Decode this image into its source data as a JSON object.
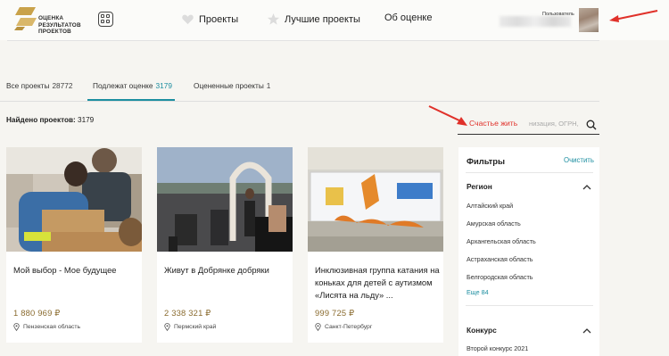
{
  "brand": {
    "logo_text": "ОЦЕНКА РЕЗУЛЬТАТОВ ПРОЕКТОВ",
    "logo_line1": "ОЦЕНКА",
    "logo_line2": "РЕЗУЛЬТАТОВ",
    "logo_line3": "ПРОЕКТОВ",
    "accent": "#1c8ea0",
    "gold": "#c9a24a"
  },
  "nav": {
    "items": [
      {
        "label": "Проекты",
        "icon": "heart-icon"
      },
      {
        "label": "Лучшие проекты",
        "icon": "star-icon"
      },
      {
        "label": "Об оценке",
        "icon": ""
      }
    ]
  },
  "user": {
    "label": "Пользователь"
  },
  "tabs": [
    {
      "label": "Все проекты",
      "count": "28772",
      "active": false
    },
    {
      "label": "Подлежат оценке",
      "count": "3179",
      "active": true
    },
    {
      "label": "Оцененные проекты",
      "count": "1",
      "active": false
    }
  ],
  "results": {
    "label": "Найдено проектов:",
    "count": "3179"
  },
  "search": {
    "value": "Счастье жить",
    "placeholder": "низация, ОГРН, И"
  },
  "cards": [
    {
      "title": "Мой выбор - Мое будущее",
      "price": "1 880 969 ₽",
      "region": "Пензенская область"
    },
    {
      "title": "Живут в Добрянке добряки",
      "price": "2 338 321 ₽",
      "region": "Пермский край"
    },
    {
      "title": "Инклюзивная группа катания на коньках для детей с аутизмом «Лисята на льду» ...",
      "price": "999 725 ₽",
      "region": "Санкт-Петербург"
    }
  ],
  "filters": {
    "title": "Фильтры",
    "clear": "Очистить",
    "region": {
      "title": "Регион",
      "items": [
        "Алтайский край",
        "Амурская область",
        "Архангельская область",
        "Астраханская область",
        "Белгородская область"
      ],
      "more": "Еще 84"
    },
    "contest": {
      "title": "Конкурс",
      "items": [
        "Второй конкурс 2021"
      ]
    }
  }
}
